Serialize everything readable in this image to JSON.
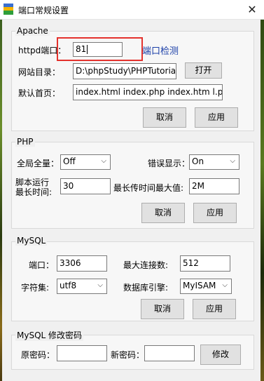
{
  "window": {
    "title": "端口常规设置",
    "close_glyph": "✕"
  },
  "apache": {
    "group_title": "Apache",
    "port_label": "httpd端口：",
    "port_value": "81",
    "port_check_link": "端口检测",
    "root_label": "网站目录：",
    "root_value": "D:\\phpStudy\\PHPTutorial\\WW",
    "open_button": "打开",
    "index_label": "默认首页：",
    "index_value": "index.html index.php index.htm l.php",
    "cancel_button": "取消",
    "apply_button": "应用"
  },
  "php": {
    "group_title": "PHP",
    "global_label": "全局全量：",
    "global_value": "Off",
    "error_label": "错误显示：",
    "error_value": "On",
    "script_label_line1": "脚本运行",
    "script_label_line2": "最长时间:",
    "script_value": "30",
    "upload_label": "最长传时间最大值:",
    "upload_value": "2M",
    "cancel_button": "取消",
    "apply_button": "应用"
  },
  "mysql": {
    "group_title": "MySQL",
    "port_label": "端口：",
    "port_value": "3306",
    "maxconn_label": "最大连接数:",
    "maxconn_value": "512",
    "charset_label": "字符集:",
    "charset_value": "utf8",
    "engine_label": "数据库引擎:",
    "engine_value": "MyISAM",
    "cancel_button": "取消",
    "apply_button": "应用"
  },
  "password": {
    "group_title": "MySQL 修改密码",
    "old_label": "原密码：",
    "old_value": "",
    "new_label": "新密码：",
    "new_value": "",
    "modify_button": "修改"
  },
  "icons": {
    "app": "app-icon",
    "dropdown": "chevron-down-icon",
    "dropdown_glyph": "⌵"
  },
  "colors": {
    "highlight_border": "#e4322d",
    "link": "#1b3fa8"
  }
}
